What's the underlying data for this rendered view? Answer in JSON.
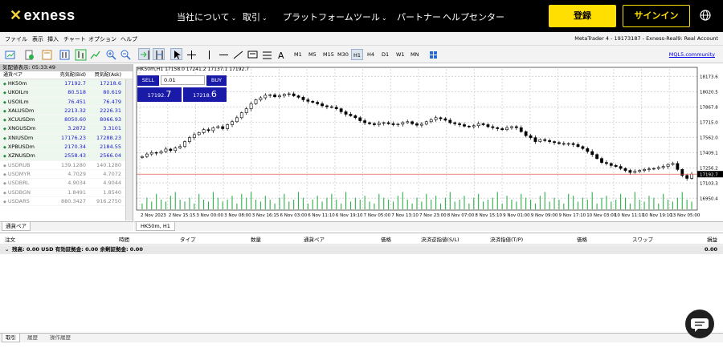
{
  "nav": {
    "brand": "exness",
    "items": [
      "当社について",
      "取引",
      "プラットフォーム",
      "ツール",
      "パートナー",
      "ヘルプセンター"
    ],
    "register": "登録",
    "signin": "サインイン"
  },
  "menubar": {
    "items": [
      "ファイル",
      "表示",
      "挿入",
      "チャート",
      "オプション",
      "ヘルプ"
    ],
    "account": "MetaTrader 4 - 19173187 - Exness-Real9: Real Account"
  },
  "toolbar": {
    "timeframes": [
      "M1",
      "M5",
      "M15",
      "M30",
      "H1",
      "H4",
      "D1",
      "W1",
      "MN"
    ],
    "selected_timeframe": "H1",
    "mql_link": "MQL5.community"
  },
  "watch": {
    "title": "気配値表示: 05:33:49",
    "headers": [
      "通貨ペア",
      "売気配(Bid)",
      "買気配(Ask)"
    ],
    "rows": [
      {
        "symbol": "HK50m",
        "bid": "17192.7",
        "ask": "17218.6",
        "active": true
      },
      {
        "symbol": "UKOILm",
        "bid": "80.518",
        "ask": "80.619",
        "active": true
      },
      {
        "symbol": "USOILm",
        "bid": "76.451",
        "ask": "76.479",
        "active": true
      },
      {
        "symbol": "XALUSDm",
        "bid": "2213.32",
        "ask": "2226.31",
        "active": true
      },
      {
        "symbol": "XCUUSDm",
        "bid": "8050.60",
        "ask": "8066.93",
        "active": true
      },
      {
        "symbol": "XNGUSDm",
        "bid": "3.2872",
        "ask": "3.3101",
        "active": true
      },
      {
        "symbol": "XNIUSDm",
        "bid": "17176.23",
        "ask": "17288.23",
        "active": true
      },
      {
        "symbol": "XPBUSDm",
        "bid": "2170.34",
        "ask": "2184.55",
        "active": true
      },
      {
        "symbol": "XZNUSDm",
        "bid": "2558.43",
        "ask": "2566.04",
        "active": true
      },
      {
        "symbol": "USDRUB",
        "bid": "139.1280",
        "ask": "140.1280",
        "active": false
      },
      {
        "symbol": "USDMYR",
        "bid": "4.7029",
        "ask": "4.7072",
        "active": false
      },
      {
        "symbol": "USDBRL",
        "bid": "4.9034",
        "ask": "4.9044",
        "active": false
      },
      {
        "symbol": "USDBGN",
        "bid": "1.8491",
        "ask": "1.8540",
        "active": false
      },
      {
        "symbol": "USDARS",
        "bid": "880.3427",
        "ask": "916.2750",
        "active": false
      }
    ],
    "tab": "通貨ペア"
  },
  "chart": {
    "info": "HK50m,H1  17158.0 17241.2 17137.1 17192.7",
    "tab": "HK50m, H1",
    "oneclick": {
      "sell": "SELL",
      "buy": "BUY",
      "lot": "0.01",
      "sell_price_small": "17192.",
      "sell_price_big": "7",
      "buy_price_small": "17218.",
      "buy_price_big": "6"
    }
  },
  "chart_data": {
    "type": "candlestick",
    "symbol": "HK50m",
    "timeframe": "H1",
    "y_ticks": [
      "18173.6",
      "18020.5",
      "17867.8",
      "17715.0",
      "17562.0",
      "17409.1",
      "17256.2",
      "17103.3",
      "16950.4"
    ],
    "ylim": [
      16880,
      18250
    ],
    "current_price_label": "17192.7",
    "x_ticks": [
      "2 Nov 2023",
      "2 Nov 15:15",
      "3 Nov 00:00",
      "3 Nov 08:00",
      "3 Nov 16:15",
      "6 Nov 03:00",
      "6 Nov 11:10",
      "6 Nov 19:10",
      "7 Nov 05:00",
      "7 Nov 13:10",
      "7 Nov 23:00",
      "8 Nov 07:00",
      "8 Nov 15:10",
      "9 Nov 01:00",
      "9 Nov 09:00",
      "9 Nov 17:10",
      "10 Nov 03:00",
      "10 Nov 11:10",
      "10 Nov 19:10",
      "13 Nov 05:00"
    ],
    "closes": [
      17370,
      17395,
      17410,
      17405,
      17420,
      17445,
      17430,
      17455,
      17470,
      17520,
      17560,
      17590,
      17610,
      17640,
      17630,
      17660,
      17670,
      17650,
      17690,
      17720,
      17760,
      17810,
      17850,
      17900,
      17940,
      17960,
      17985,
      17990,
      17970,
      17980,
      17995,
      18000,
      17980,
      17965,
      17940,
      17925,
      17915,
      17900,
      17880,
      17870,
      17865,
      17850,
      17820,
      17795,
      17780,
      17760,
      17730,
      17710,
      17700,
      17690,
      17705,
      17710,
      17700,
      17690,
      17695,
      17710,
      17720,
      17700,
      17685,
      17695,
      17720,
      17740,
      17760,
      17750,
      17735,
      17710,
      17700,
      17690,
      17675,
      17670,
      17680,
      17700,
      17690,
      17670,
      17660,
      17650,
      17640,
      17660,
      17670,
      17660,
      17620,
      17580,
      17560,
      17520,
      17540,
      17530,
      17520,
      17510,
      17500,
      17495,
      17500,
      17490,
      17470,
      17450,
      17420,
      17390,
      17350,
      17310,
      17300,
      17280,
      17270,
      17250,
      17230,
      17210,
      17220,
      17230,
      17240,
      17245,
      17250,
      17260,
      17270,
      17290,
      17300,
      17240,
      17180,
      17150,
      17192.7
    ],
    "volumes": [
      0.3,
      0.6,
      0.4,
      0.8,
      0.5,
      0.4,
      0.7,
      0.9,
      0.5,
      0.4,
      0.6,
      0.3,
      0.8,
      0.5,
      0.4,
      0.9,
      0.6,
      0.4,
      0.5,
      0.7,
      0.3,
      0.8,
      0.6,
      0.9,
      0.5,
      0.4,
      0.7,
      0.5,
      0.3,
      0.6,
      0.8,
      0.4,
      0.5,
      0.9,
      0.6,
      0.3,
      0.5,
      0.7,
      0.4,
      0.6,
      0.8,
      0.5,
      0.3,
      0.9,
      0.4,
      0.6,
      0.5,
      0.7,
      0.4,
      0.3,
      0.8,
      0.6,
      0.5,
      0.4,
      0.7,
      0.9,
      0.5,
      0.3,
      0.6,
      0.4,
      0.8,
      0.5,
      0.7,
      0.3,
      0.6,
      0.9,
      0.4,
      0.5,
      0.7,
      0.3,
      0.6,
      0.8,
      0.4,
      0.5,
      0.6,
      0.9,
      0.3,
      0.7,
      0.5,
      0.4,
      0.8,
      0.6,
      0.5,
      0.3,
      0.7,
      0.9,
      0.4,
      0.6,
      0.5,
      0.3,
      0.8,
      0.7,
      0.4,
      0.6,
      0.5,
      0.9,
      0.3,
      0.6,
      0.7,
      0.4,
      0.5,
      0.8,
      0.6,
      0.3,
      0.9,
      0.5,
      0.4,
      0.7,
      0.6,
      0.3,
      0.8,
      0.5,
      0.4,
      0.6,
      0.9,
      0.5,
      0.4
    ]
  },
  "terminal": {
    "columns": [
      "注文",
      "時間",
      "タイプ",
      "数量",
      "通貨ペア",
      "価格",
      "決済逆指値(S/L)",
      "決済指値(T/P)",
      "価格",
      "スワップ",
      "損益"
    ],
    "balance": "残高: 0.00 USD  有効証拠金: 0.00  余剰証拠金: 0.00",
    "balance_value": "0.00",
    "tabs": [
      "取引",
      "履歴",
      "操作履歴"
    ]
  },
  "colors": {
    "accent": "#ffde02",
    "buy_sell": "#1a1aa8",
    "volume": "#2db14a",
    "price_line": "#e0402a"
  }
}
